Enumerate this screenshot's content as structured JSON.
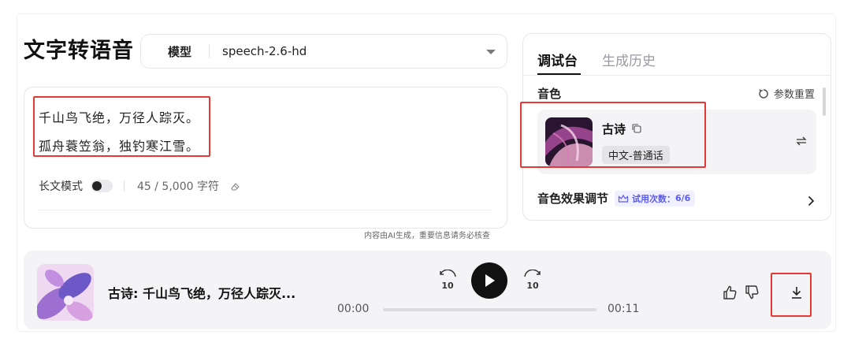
{
  "page": {
    "title": "文字转语音",
    "model_label": "模型",
    "model_value": "speech-2.6-hd"
  },
  "editor": {
    "lines": [
      "千山鸟飞绝，万径人踪灭。",
      "孤舟蓑笠翁，独钓寒江雪。"
    ],
    "long_mode_label": "长文模式",
    "long_mode_on": false,
    "char_count": "45 / 5,000 字符"
  },
  "disclaimer": "内容由AI生成，重要信息请务必核查",
  "panel": {
    "tabs": [
      {
        "label": "调试台",
        "active": true
      },
      {
        "label": "生成历史",
        "active": false
      }
    ],
    "voice_section_label": "音色",
    "reset_label": "参数重置",
    "voice": {
      "name": "古诗",
      "tag": "中文-普通话"
    },
    "effect_label": "音色效果调节",
    "trial_label": "试用次数：",
    "trial_count": "6/6"
  },
  "player": {
    "title": "古诗: 千山鸟飞绝，万径人踪灭...",
    "current_time": "00:00",
    "total_time": "00:11",
    "progress": 0,
    "skip_back": "10",
    "skip_forward": "10"
  },
  "colors": {
    "highlight": "#e53935",
    "accent": "#5a5af0"
  },
  "icons": [
    "chevron-down-icon",
    "eraser-icon",
    "reset-icon",
    "copy-icon",
    "swap-icon",
    "crown-icon",
    "chevron-right-icon",
    "rewind-10-icon",
    "play-icon",
    "forward-10-icon",
    "thumbs-up-icon",
    "thumbs-down-icon",
    "download-icon"
  ]
}
